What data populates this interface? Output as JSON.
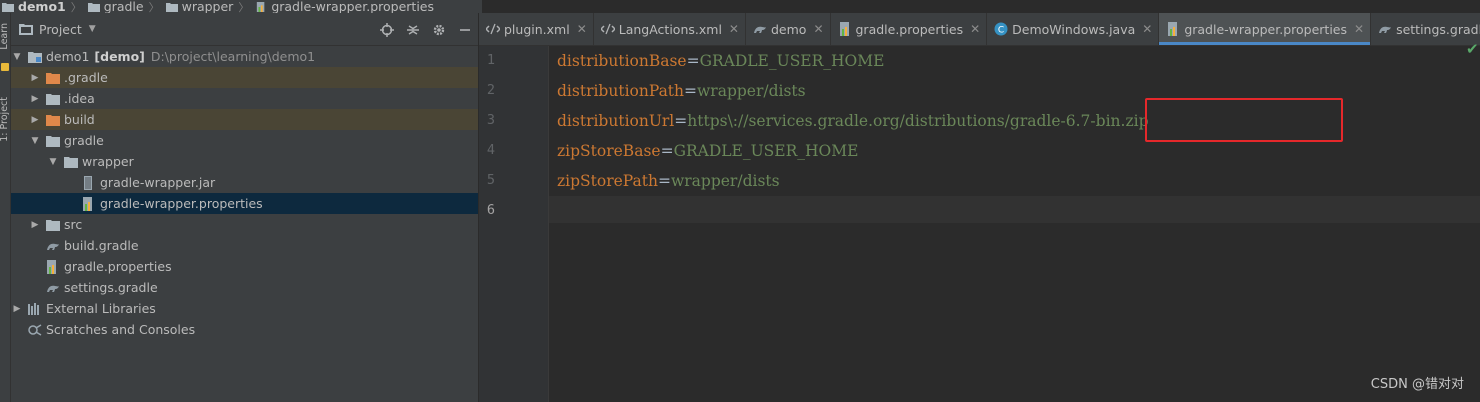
{
  "breadcrumb": [
    "demo1",
    "gradle",
    "wrapper",
    "gradle-wrapper.properties"
  ],
  "tool_strip": {
    "learn_label": "Learn",
    "project_label": "1: Project"
  },
  "project_panel": {
    "title": "Project",
    "tree": [
      {
        "label": "demo1",
        "module": "[demo]",
        "path": "D:\\project\\learning\\demo1",
        "icon": "module-folder-icon",
        "expanded": true
      },
      {
        "label": ".gradle",
        "icon": "folder-excluded-icon",
        "excluded": true
      },
      {
        "label": ".idea",
        "icon": "folder-icon"
      },
      {
        "label": "build",
        "icon": "folder-excluded-icon",
        "excluded": true
      },
      {
        "label": "gradle",
        "icon": "folder-icon",
        "expanded": true
      },
      {
        "label": "wrapper",
        "icon": "folder-icon",
        "expanded": true
      },
      {
        "label": "gradle-wrapper.jar",
        "icon": "jar-icon"
      },
      {
        "label": "gradle-wrapper.properties",
        "icon": "properties-icon",
        "selected": true
      },
      {
        "label": "src",
        "icon": "folder-icon"
      },
      {
        "label": "build.gradle",
        "icon": "gradle-icon"
      },
      {
        "label": "gradle.properties",
        "icon": "properties-icon"
      },
      {
        "label": "settings.gradle",
        "icon": "gradle-icon"
      },
      {
        "label": "External Libraries",
        "icon": "libraries-icon"
      },
      {
        "label": "Scratches and Consoles",
        "icon": "scratches-icon"
      }
    ]
  },
  "tabs": [
    {
      "label": "plugin.xml",
      "icon": "xml-icon"
    },
    {
      "label": "LangActions.xml",
      "icon": "xml-icon"
    },
    {
      "label": "demo",
      "icon": "gradle-icon"
    },
    {
      "label": "gradle.properties",
      "icon": "properties-icon"
    },
    {
      "label": "DemoWindows.java",
      "icon": "java-class-icon"
    },
    {
      "label": "gradle-wrapper.properties",
      "icon": "properties-icon",
      "active": true
    },
    {
      "label": "settings.gradle",
      "icon": "gradle-icon"
    }
  ],
  "editor": {
    "line_numbers": [
      "1",
      "2",
      "3",
      "4",
      "5",
      "6"
    ],
    "current_line": 6,
    "lines": [
      {
        "key": "distributionBase",
        "sep": "=",
        "value": "GRADLE_USER_HOME"
      },
      {
        "key": "distributionPath",
        "sep": "=",
        "value": "wrapper/dists"
      },
      {
        "key": "distributionUrl",
        "sep": "=",
        "value": "https\\://services.gradle.org/distributions/gradle-6.7-bin.zip"
      },
      {
        "key": "zipStoreBase",
        "sep": "=",
        "value": "GRADLE_USER_HOME"
      },
      {
        "key": "zipStorePath",
        "sep": "=",
        "value": "wrapper/dists"
      },
      {
        "key": "",
        "sep": "",
        "value": ""
      }
    ]
  },
  "watermark": "CSDN @错对对",
  "colors": {
    "accent": "#4a88c7",
    "highlight_box": "#e5282b",
    "key": "#cc7832",
    "value": "#6a8759"
  }
}
